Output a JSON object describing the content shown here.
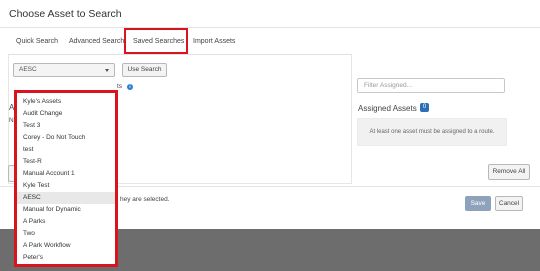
{
  "dialog": {
    "title": "Choose Asset to Search"
  },
  "tabs": [
    {
      "label": "Quick Search"
    },
    {
      "label": "Advanced Search"
    },
    {
      "label": "Saved Searches"
    },
    {
      "label": "Import Assets"
    }
  ],
  "saved_search": {
    "selected_value": "AESC",
    "use_button": "Use Search",
    "partial_label": "ts",
    "options": [
      "Kyle's Assets",
      "Audit Change",
      "Test 3",
      "Corey - Do Not Touch",
      "test",
      "Test-R",
      "Manual Account 1",
      "Kyle Test",
      "AESC",
      "Manual for Dynamic",
      "A Parks",
      "Two",
      "A Park Workflow",
      "Peter's"
    ]
  },
  "left_partial": {
    "heading_fragment": "A",
    "label_fragment": "N"
  },
  "assigned": {
    "filter_placeholder": "Filter Assigned...",
    "title": "Assigned Assets",
    "count": "0",
    "empty_message": "At least one asset must be assigned to a route.",
    "remove_all": "Remove All"
  },
  "footer": {
    "selection_note": "hey are selected.",
    "save_label": "Save",
    "cancel_label": "Cancel"
  },
  "colors": {
    "highlight": "#d9141e",
    "accent": "#2d6fb7"
  }
}
